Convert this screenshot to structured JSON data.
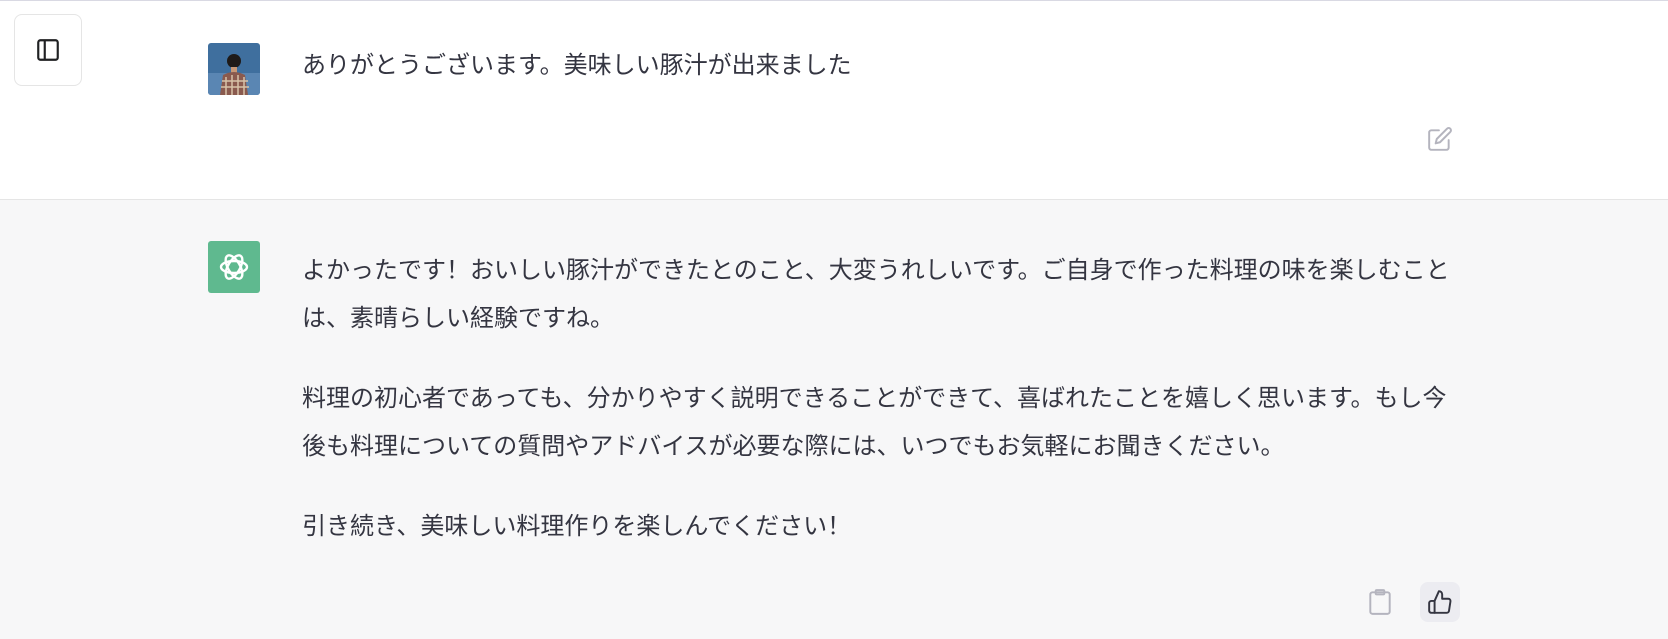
{
  "colors": {
    "assistant_bg": "#f7f7f8",
    "bot_avatar": "#5fb98f",
    "text": "#343541",
    "icon_muted": "#b4b4be"
  },
  "toolbar": {
    "sidebar_toggle_icon": "sidebar-toggle-icon"
  },
  "user_message": {
    "avatar_icon": "user-avatar-photo",
    "text": "ありがとうございます。美味しい豚汁が出来ました",
    "edit_icon": "edit-icon"
  },
  "assistant_message": {
    "avatar_icon": "chatgpt-logo-icon",
    "paragraphs": [
      "よかったです！おいしい豚汁ができたとのこと、大変うれしいです。ご自身で作った料理の味を楽しむことは、素晴らしい経験ですね。",
      "料理の初心者であっても、分かりやすく説明できることができて、喜ばれたことを嬉しく思います。もし今後も料理についての質問やアドバイスが必要な際には、いつでもお気軽にお聞きください。",
      "引き続き、美味しい料理作りを楽しんでください！"
    ],
    "copy_icon": "clipboard-icon",
    "like_icon": "thumbs-up-icon"
  }
}
